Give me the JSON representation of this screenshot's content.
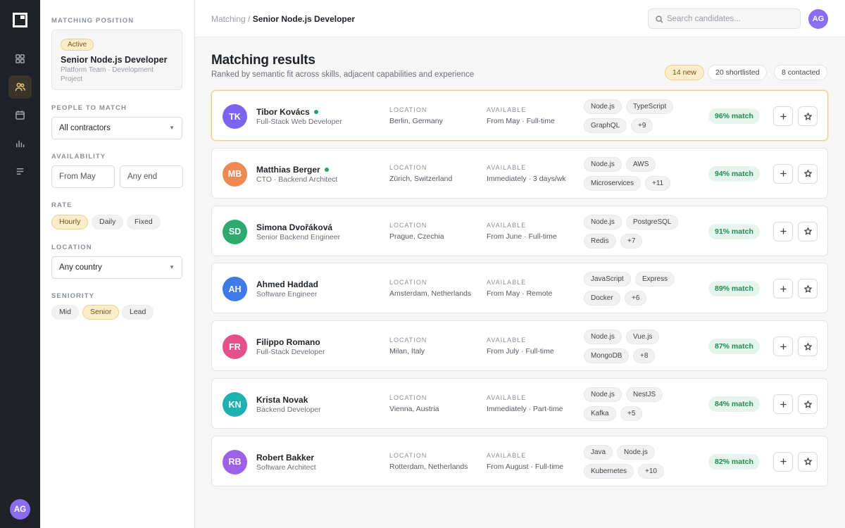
{
  "rail": {
    "items": [
      {
        "icon": "grid-icon",
        "active": false
      },
      {
        "icon": "users-icon",
        "active": true
      },
      {
        "icon": "calendar-icon",
        "active": false
      },
      {
        "icon": "bar-chart-icon",
        "active": false
      },
      {
        "icon": "list-icon",
        "active": false
      }
    ],
    "avatar": "AG"
  },
  "filters": {
    "position_label": "MATCHING POSITION",
    "position": {
      "badge": "Active",
      "title": "Senior Node.js Developer",
      "subtitle": "Platform Team · Development Project"
    },
    "people_label": "PEOPLE TO MATCH",
    "people_value": "All contractors",
    "availability_label": "AVAILABILITY",
    "availability_from": "From May",
    "availability_end": "Any end",
    "rate_label": "RATE",
    "rate_options": [
      {
        "label": "Hourly",
        "selected": true
      },
      {
        "label": "Daily",
        "selected": false
      },
      {
        "label": "Fixed",
        "selected": false
      }
    ],
    "location_label": "LOCATION",
    "location_value": "Any country",
    "seniority_label": "SENIORITY",
    "seniority_options": [
      {
        "label": "Mid",
        "selected": false
      },
      {
        "label": "Senior",
        "selected": true
      },
      {
        "label": "Lead",
        "selected": false
      }
    ]
  },
  "header": {
    "breadcrumb_parent": "Matching /",
    "breadcrumb_current": "Senior Node.js Developer",
    "search_placeholder": "Search candidates...",
    "avatar": "AG"
  },
  "main": {
    "title": "Matching results",
    "subtitle": "Ranked by semantic fit across skills, adjacent capabilities and experience",
    "stats": [
      "14 new",
      "20 shortlisted",
      "8 contacted"
    ],
    "location_label": "LOCATION",
    "available_label": "AVAILABLE",
    "candidates": [
      {
        "initials": "TK",
        "name": "Tibor Kovács",
        "online": true,
        "role": "Full-Stack Web Developer",
        "location": "Berlin, Germany",
        "available": "From May · Full-time",
        "tags": [
          "Node.js",
          "TypeScript",
          "GraphQL",
          "+9"
        ],
        "match": "96% match",
        "color": "#7c63f0",
        "highlight": true
      },
      {
        "initials": "MB",
        "name": "Matthias Berger",
        "online": true,
        "role": "CTO · Backend Architect",
        "location": "Zürich, Switzerland",
        "available": "Immediately · 3 days/wk",
        "tags": [
          "Node.js",
          "AWS",
          "Microservices",
          "+11"
        ],
        "match": "94% match",
        "color": "#f08a55",
        "highlight": false
      },
      {
        "initials": "SD",
        "name": "Simona Dvořáková",
        "online": false,
        "role": "Senior Backend Engineer",
        "location": "Prague, Czechia",
        "available": "From June · Full-time",
        "tags": [
          "Node.js",
          "PostgreSQL",
          "Redis",
          "+7"
        ],
        "match": "91% match",
        "color": "#2faa6f",
        "highlight": false
      },
      {
        "initials": "AH",
        "name": "Ahmed Haddad",
        "online": false,
        "role": "Software Engineer",
        "location": "Amsterdam, Netherlands",
        "available": "From May · Remote",
        "tags": [
          "JavaScript",
          "Express",
          "Docker",
          "+6"
        ],
        "match": "89% match",
        "color": "#3f7ae6",
        "highlight": false
      },
      {
        "initials": "FR",
        "name": "Filippo Romano",
        "online": false,
        "role": "Full-Stack Developer",
        "location": "Milan, Italy",
        "available": "From July · Full-time",
        "tags": [
          "Node.js",
          "Vue.js",
          "MongoDB",
          "+8"
        ],
        "match": "87% match",
        "color": "#e6508a",
        "highlight": false
      },
      {
        "initials": "KN",
        "name": "Krista Novak",
        "online": false,
        "role": "Backend Developer",
        "location": "Vienna, Austria",
        "available": "Immediately · Part-time",
        "tags": [
          "Node.js",
          "NestJS",
          "Kafka",
          "+5"
        ],
        "match": "84% match",
        "color": "#1fb0b0",
        "highlight": false
      },
      {
        "initials": "RB",
        "name": "Robert Bakker",
        "online": false,
        "role": "Software Architect",
        "location": "Rotterdam, Netherlands",
        "available": "From August · Full-time",
        "tags": [
          "Java",
          "Node.js",
          "Kubernetes",
          "+10"
        ],
        "match": "82% match",
        "color": "#9b62e8",
        "highlight": false
      }
    ]
  }
}
